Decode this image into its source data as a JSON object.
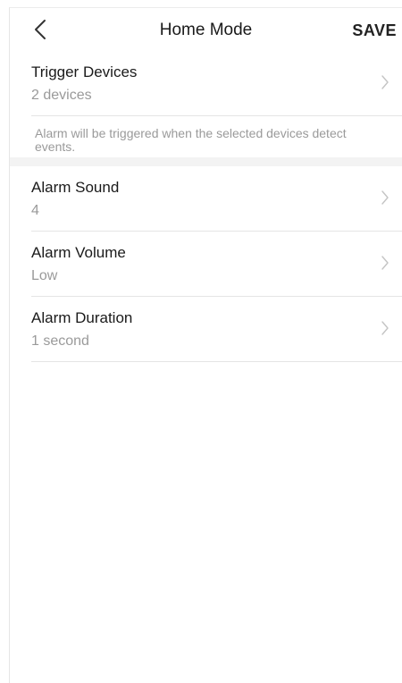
{
  "header": {
    "title": "Home Mode",
    "save_label": "SAVE",
    "back_icon": "chevron-left-icon"
  },
  "trigger": {
    "title": "Trigger Devices",
    "value": "2 devices",
    "hint": "Alarm will be triggered when the selected devices detect events."
  },
  "settings": [
    {
      "title": "Alarm Sound",
      "value": "4"
    },
    {
      "title": "Alarm Volume",
      "value": "Low"
    },
    {
      "title": "Alarm Duration",
      "value": "1 second"
    }
  ],
  "colors": {
    "text": "#1a1a1a",
    "secondary": "#9a9a9a",
    "divider": "#e5e5e5",
    "section_gap": "#f3f3f3"
  }
}
